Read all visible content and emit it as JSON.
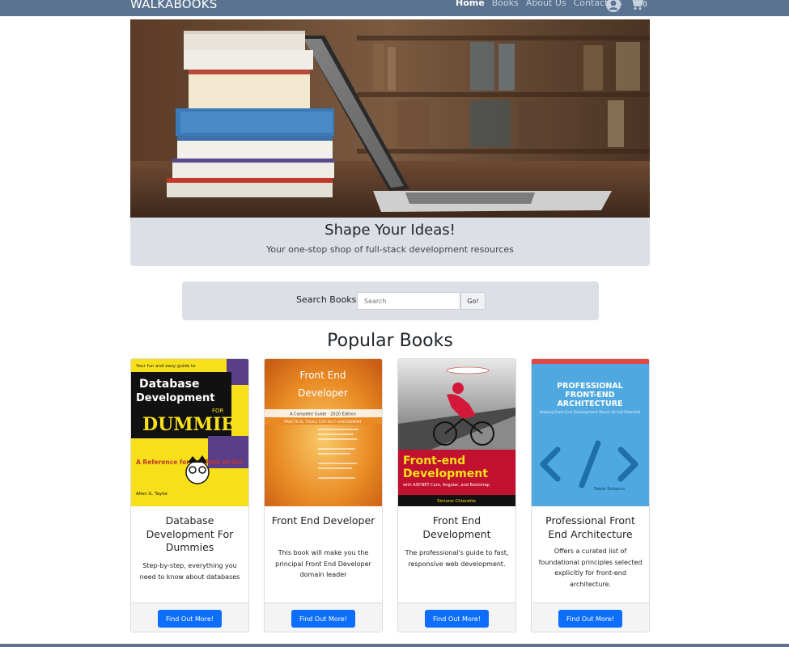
{
  "navbar": {
    "brand": "WALKABOOKS",
    "links": [
      {
        "label": "Home",
        "active": true
      },
      {
        "label": "Books",
        "active": false
      },
      {
        "label": "About Us",
        "active": false
      },
      {
        "label": "Contact Us",
        "active": false
      }
    ],
    "user_icon": "user-circle-icon",
    "cart_icon": "shopping-cart-icon",
    "cart_count": "0",
    "background": "#5a7391"
  },
  "hero": {
    "image": "books-and-laptop-photo",
    "title": "Shape Your Ideas!",
    "subtitle": "Your one-stop shop of full-stack development resources"
  },
  "search": {
    "label": "Search Books",
    "placeholder": "Search",
    "button": "Go!"
  },
  "popular": {
    "title": "Popular Books",
    "books": [
      {
        "cover_text": [
          "Your fun and easy guide to",
          "Database",
          "Development",
          "FOR",
          "DUMMIES",
          "A Reference for the Rest of Us!",
          "Allen G. Taylor"
        ],
        "title": "Database Development For Dummies",
        "description": "Step-by-step, everything you need to know about databases",
        "button": "Find Out More!"
      },
      {
        "cover_text": [
          "Front End",
          "Developer",
          "A Complete Guide · 2020 Edition",
          "PRACTICAL TOOLS FOR SELF-ASSESSMENT"
        ],
        "title": "Front End Developer",
        "description": "This book will make you the principal Front End Developer domain leader",
        "button": "Find Out More!"
      },
      {
        "cover_text": [
          "Front-end",
          "Development",
          "with ASP.NET Core, Angular, and Bootstrap",
          "Simone Chiaretta"
        ],
        "title": "Front End Development",
        "description": "The professional's guide to fast, responsive web development.",
        "button": "Find Out More!"
      },
      {
        "cover_text": [
          "PROFESSIONAL",
          "FRONT-END",
          "ARCHITECTURE",
          "Helping Front-End Development Reach Its Full Potential",
          "Fabio Nolasco"
        ],
        "title": "Professional Front End Architecture",
        "description": "Offers a curated list of foundational principles selected explicitly for front-end architecture.",
        "button": "Find Out More!"
      }
    ]
  },
  "colors": {
    "accent": "#0d6efd",
    "panel": "#dcdfe6"
  }
}
